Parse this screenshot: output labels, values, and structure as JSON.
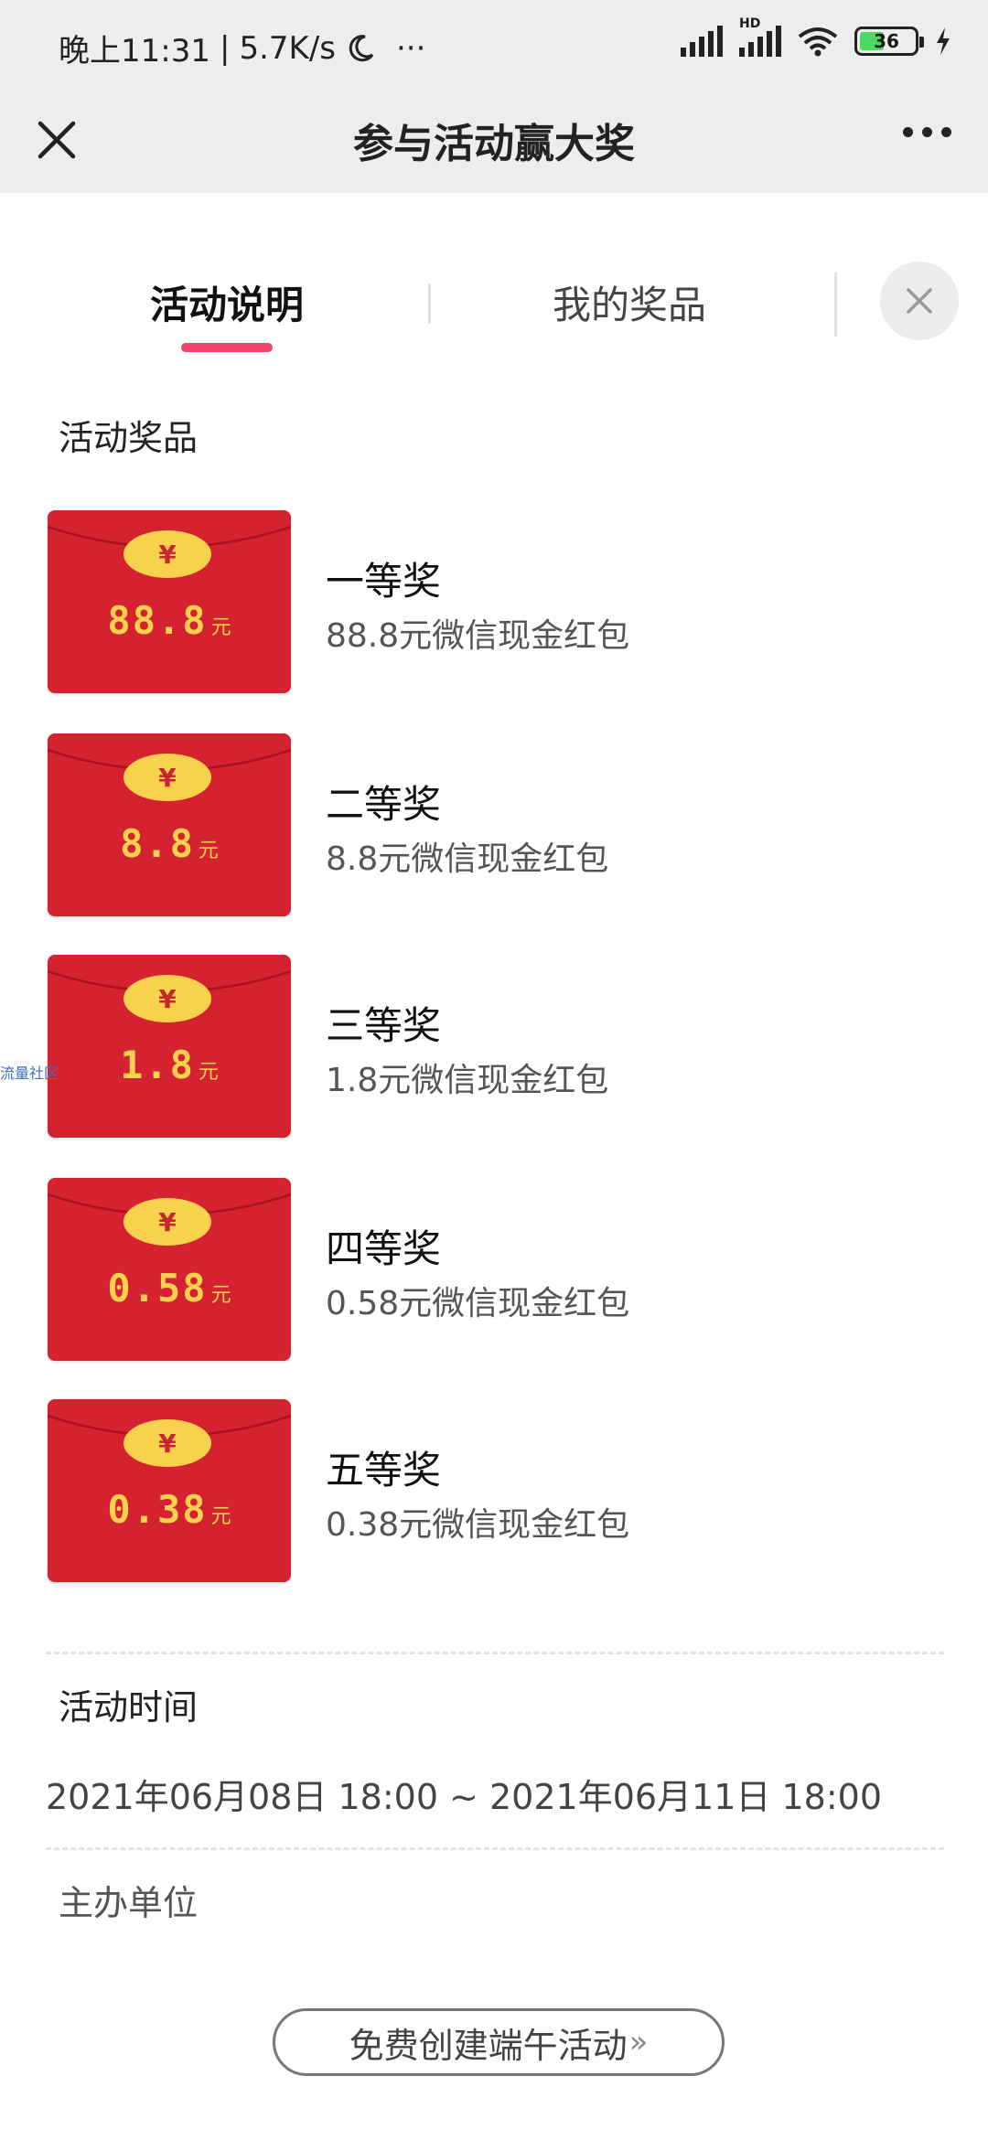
{
  "status_bar": {
    "time": "晚上11:31",
    "speed": "5.7K/s",
    "more": "···",
    "hd_label": "HD",
    "battery": "36"
  },
  "title_bar": {
    "title": "参与活动赢大奖"
  },
  "tabs": [
    {
      "label": "活动说明",
      "active": true
    },
    {
      "label": "我的奖品",
      "active": false
    }
  ],
  "sections": {
    "prizes_title": "活动奖品",
    "time_title": "活动时间",
    "organizer_title": "主办单位"
  },
  "prizes": [
    {
      "rank": "一等奖",
      "amount": "88.8",
      "unit": "元",
      "desc": "88.8元微信现金红包"
    },
    {
      "rank": "二等奖",
      "amount": "8.8",
      "unit": "元",
      "desc": "8.8元微信现金红包"
    },
    {
      "rank": "三等奖",
      "amount": "1.8",
      "unit": "元",
      "desc": "1.8元微信现金红包"
    },
    {
      "rank": "四等奖",
      "amount": "0.58",
      "unit": "元",
      "desc": "0.58元微信现金红包"
    },
    {
      "rank": "五等奖",
      "amount": "0.38",
      "unit": "元",
      "desc": "0.38元微信现金红包"
    }
  ],
  "coin_symbol": "¥",
  "activity_time": "2021年06月08日 18:00 ~ 2021年06月11日 18:00",
  "create_button": {
    "label": "免费创建端午活动",
    "arrows": "»"
  },
  "watermark": "流量社区",
  "colors": {
    "envelope": "#d42230",
    "coin": "#f8d24c",
    "accent": "#f0436d",
    "highlight": "#ffe8ec"
  }
}
